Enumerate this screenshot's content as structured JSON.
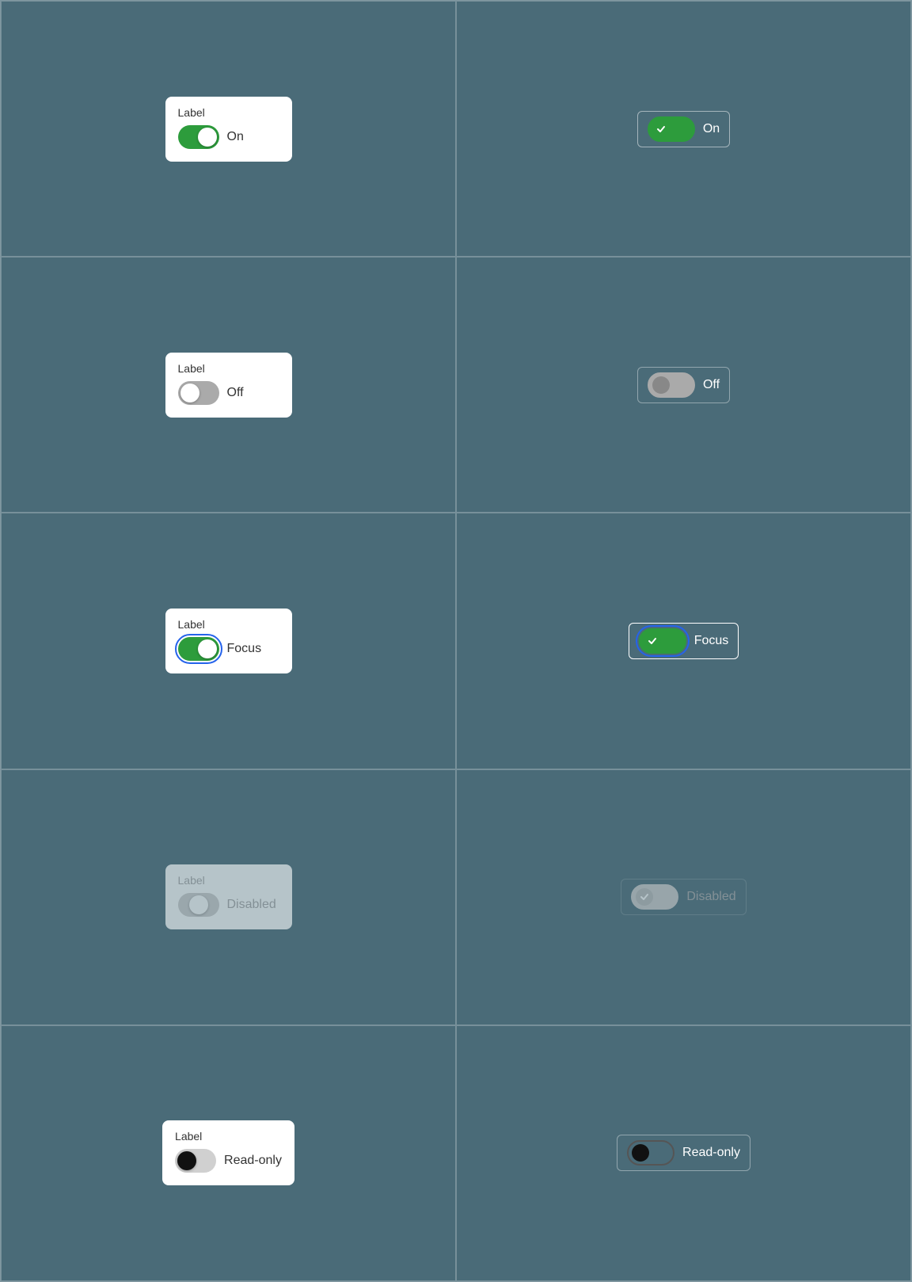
{
  "rows": [
    {
      "id": "on",
      "card_label": "Label",
      "toggle_state": "on",
      "label_text": "On",
      "compact_label": "On",
      "focus": false,
      "disabled": false,
      "readonly": false
    },
    {
      "id": "off",
      "card_label": "Label",
      "toggle_state": "off",
      "label_text": "Off",
      "compact_label": "Off",
      "focus": false,
      "disabled": false,
      "readonly": false
    },
    {
      "id": "focus",
      "card_label": "Label",
      "toggle_state": "focus",
      "label_text": "Focus",
      "compact_label": "Focus",
      "focus": true,
      "disabled": false,
      "readonly": false
    },
    {
      "id": "disabled",
      "card_label": "Label",
      "toggle_state": "disabled",
      "label_text": "Disabled",
      "compact_label": "Disabled",
      "focus": false,
      "disabled": true,
      "readonly": false
    },
    {
      "id": "readonly",
      "card_label": "Label",
      "toggle_state": "readonly",
      "label_text": "Read-only",
      "compact_label": "Read-only",
      "focus": false,
      "disabled": false,
      "readonly": true
    }
  ]
}
